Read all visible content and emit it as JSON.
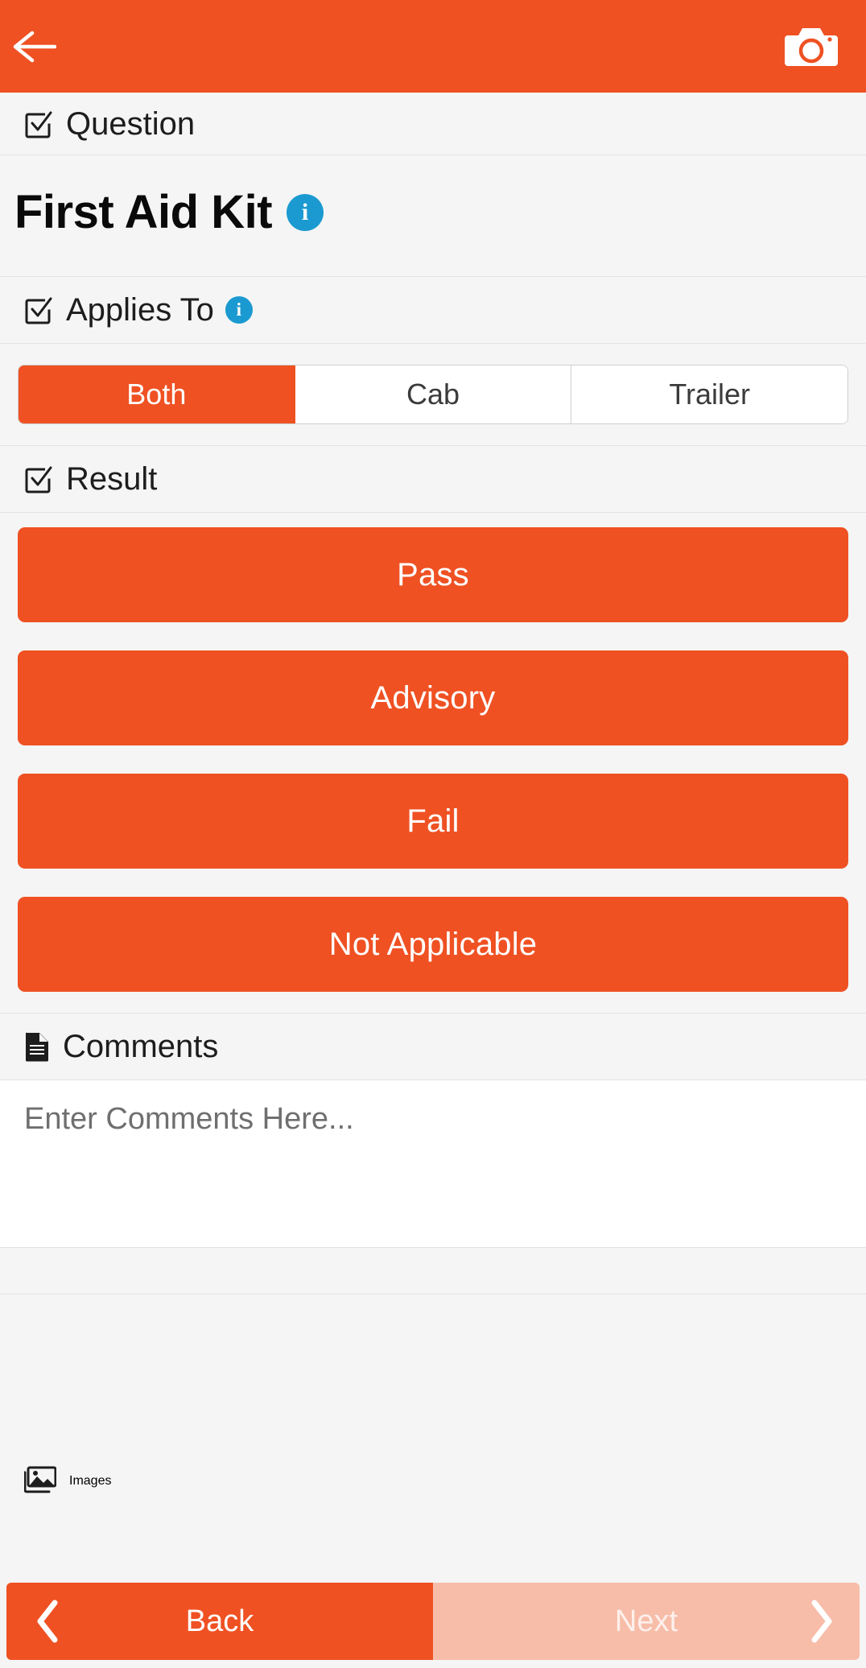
{
  "appbar": {
    "back_icon": "arrow-left-icon",
    "camera_icon": "camera-icon",
    "background_color": "#ef5123"
  },
  "sections": {
    "question": {
      "icon": "checkbox-checked-icon",
      "label": "Question"
    },
    "applies_to": {
      "icon": "checkbox-checked-icon",
      "label": "Applies To",
      "info_icon": "info-circle-icon",
      "info_glyph": "i"
    },
    "result": {
      "icon": "checkbox-checked-icon",
      "label": "Result"
    },
    "comments": {
      "icon": "document-icon",
      "label": "Comments"
    },
    "images": {
      "icon": "images-icon",
      "label": "Images"
    }
  },
  "question": {
    "title": "First Aid Kit",
    "info_icon": "info-circle-icon",
    "info_glyph": "i",
    "info_color": "#1b9ad1"
  },
  "applies_to_options": [
    {
      "label": "Both",
      "selected": true
    },
    {
      "label": "Cab",
      "selected": false
    },
    {
      "label": "Trailer",
      "selected": false
    }
  ],
  "result_buttons": [
    {
      "label": "Pass"
    },
    {
      "label": "Advisory"
    },
    {
      "label": "Fail"
    },
    {
      "label": "Not Applicable"
    }
  ],
  "comments_field": {
    "value": "",
    "placeholder": "Enter Comments Here..."
  },
  "bottom_nav": {
    "back_label": "Back",
    "next_label": "Next",
    "back_icon": "chevron-left-icon",
    "next_icon": "chevron-right-icon",
    "back_enabled": true,
    "next_enabled": false
  },
  "theme": {
    "accent": "#ef5123",
    "accent_muted": "#f7bda9",
    "info_blue": "#1b9ad1",
    "page_bg": "#f5f5f5",
    "divider": "#e2e2e2"
  }
}
